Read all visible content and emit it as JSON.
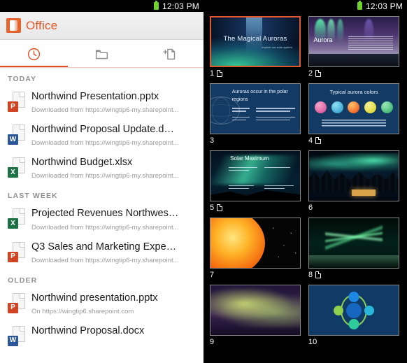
{
  "status_bar": {
    "time": "12:03 PM",
    "battery_icon": "battery-icon",
    "battery_color": "#6fd12b"
  },
  "app": {
    "name": "Office",
    "accent_color": "#e2572a",
    "logo_icon": "office-logo-icon"
  },
  "tabs": [
    {
      "id": "recent",
      "icon": "clock-icon",
      "label": "Recent",
      "active": true
    },
    {
      "id": "open",
      "icon": "folder-icon",
      "label": "Open",
      "active": false
    },
    {
      "id": "new",
      "icon": "new-document-icon",
      "label": "New",
      "active": false
    }
  ],
  "sections": [
    {
      "title": "TODAY",
      "files": [
        {
          "name": "Northwind Presentation.pptx",
          "subtitle": "Downloaded from https://wingtip6-my.sharepoint...",
          "type": "ppt",
          "badge": "P"
        },
        {
          "name": "Northwind Proposal Update.d…",
          "subtitle": "Downloaded from https://wingtip6-my.sharepoint...",
          "type": "doc",
          "badge": "W"
        },
        {
          "name": "Northwind Budget.xlsx",
          "subtitle": "Downloaded from https://wingtip6-my.sharepoint...",
          "type": "xls",
          "badge": "X"
        }
      ]
    },
    {
      "title": "LAST WEEK",
      "files": [
        {
          "name": "Projected Revenues Northwes…",
          "subtitle": "Downloaded from https://wingtip6-my.sharepoint...",
          "type": "xls",
          "badge": "X"
        },
        {
          "name": "Q3 Sales and Marketing Expe…",
          "subtitle": "Downloaded from https://wingtip6-my.sharepoint...",
          "type": "ppt",
          "badge": "P"
        }
      ]
    },
    {
      "title": "OLDER",
      "files": [
        {
          "name": "Northwind presentation.pptx",
          "subtitle": "On https://wingtip6.sharepoint.com",
          "type": "ppt",
          "badge": "P"
        },
        {
          "name": "Northwind Proposal.docx",
          "subtitle": "",
          "type": "doc",
          "badge": "W"
        }
      ]
    }
  ],
  "slides": [
    {
      "number": "1",
      "has_notes": true,
      "selected": true,
      "title": "The Magical Auroras",
      "subtitle": "explore our solar system"
    },
    {
      "number": "2",
      "has_notes": true,
      "selected": false,
      "title": "Aurora",
      "subtitle": ""
    },
    {
      "number": "3",
      "has_notes": false,
      "selected": false,
      "title": "Auroras occur in the polar regions",
      "subtitle": ""
    },
    {
      "number": "4",
      "has_notes": true,
      "selected": false,
      "title": "Typical aurora colors",
      "subtitle": "",
      "dot_colors": [
        "#e0559b",
        "#2aa9d8",
        "#ef4e18",
        "#e3de1f",
        "#34b96b"
      ]
    },
    {
      "number": "5",
      "has_notes": true,
      "selected": false,
      "title": "Solar Maximum",
      "subtitle": ""
    },
    {
      "number": "6",
      "has_notes": false,
      "selected": false,
      "title": "",
      "subtitle": ""
    },
    {
      "number": "7",
      "has_notes": false,
      "selected": false,
      "title": "",
      "subtitle": ""
    },
    {
      "number": "8",
      "has_notes": true,
      "selected": false,
      "title": "",
      "subtitle": ""
    },
    {
      "number": "9",
      "has_notes": false,
      "selected": false,
      "title": "",
      "subtitle": ""
    },
    {
      "number": "10",
      "has_notes": false,
      "selected": false,
      "title": "",
      "subtitle": ""
    }
  ]
}
